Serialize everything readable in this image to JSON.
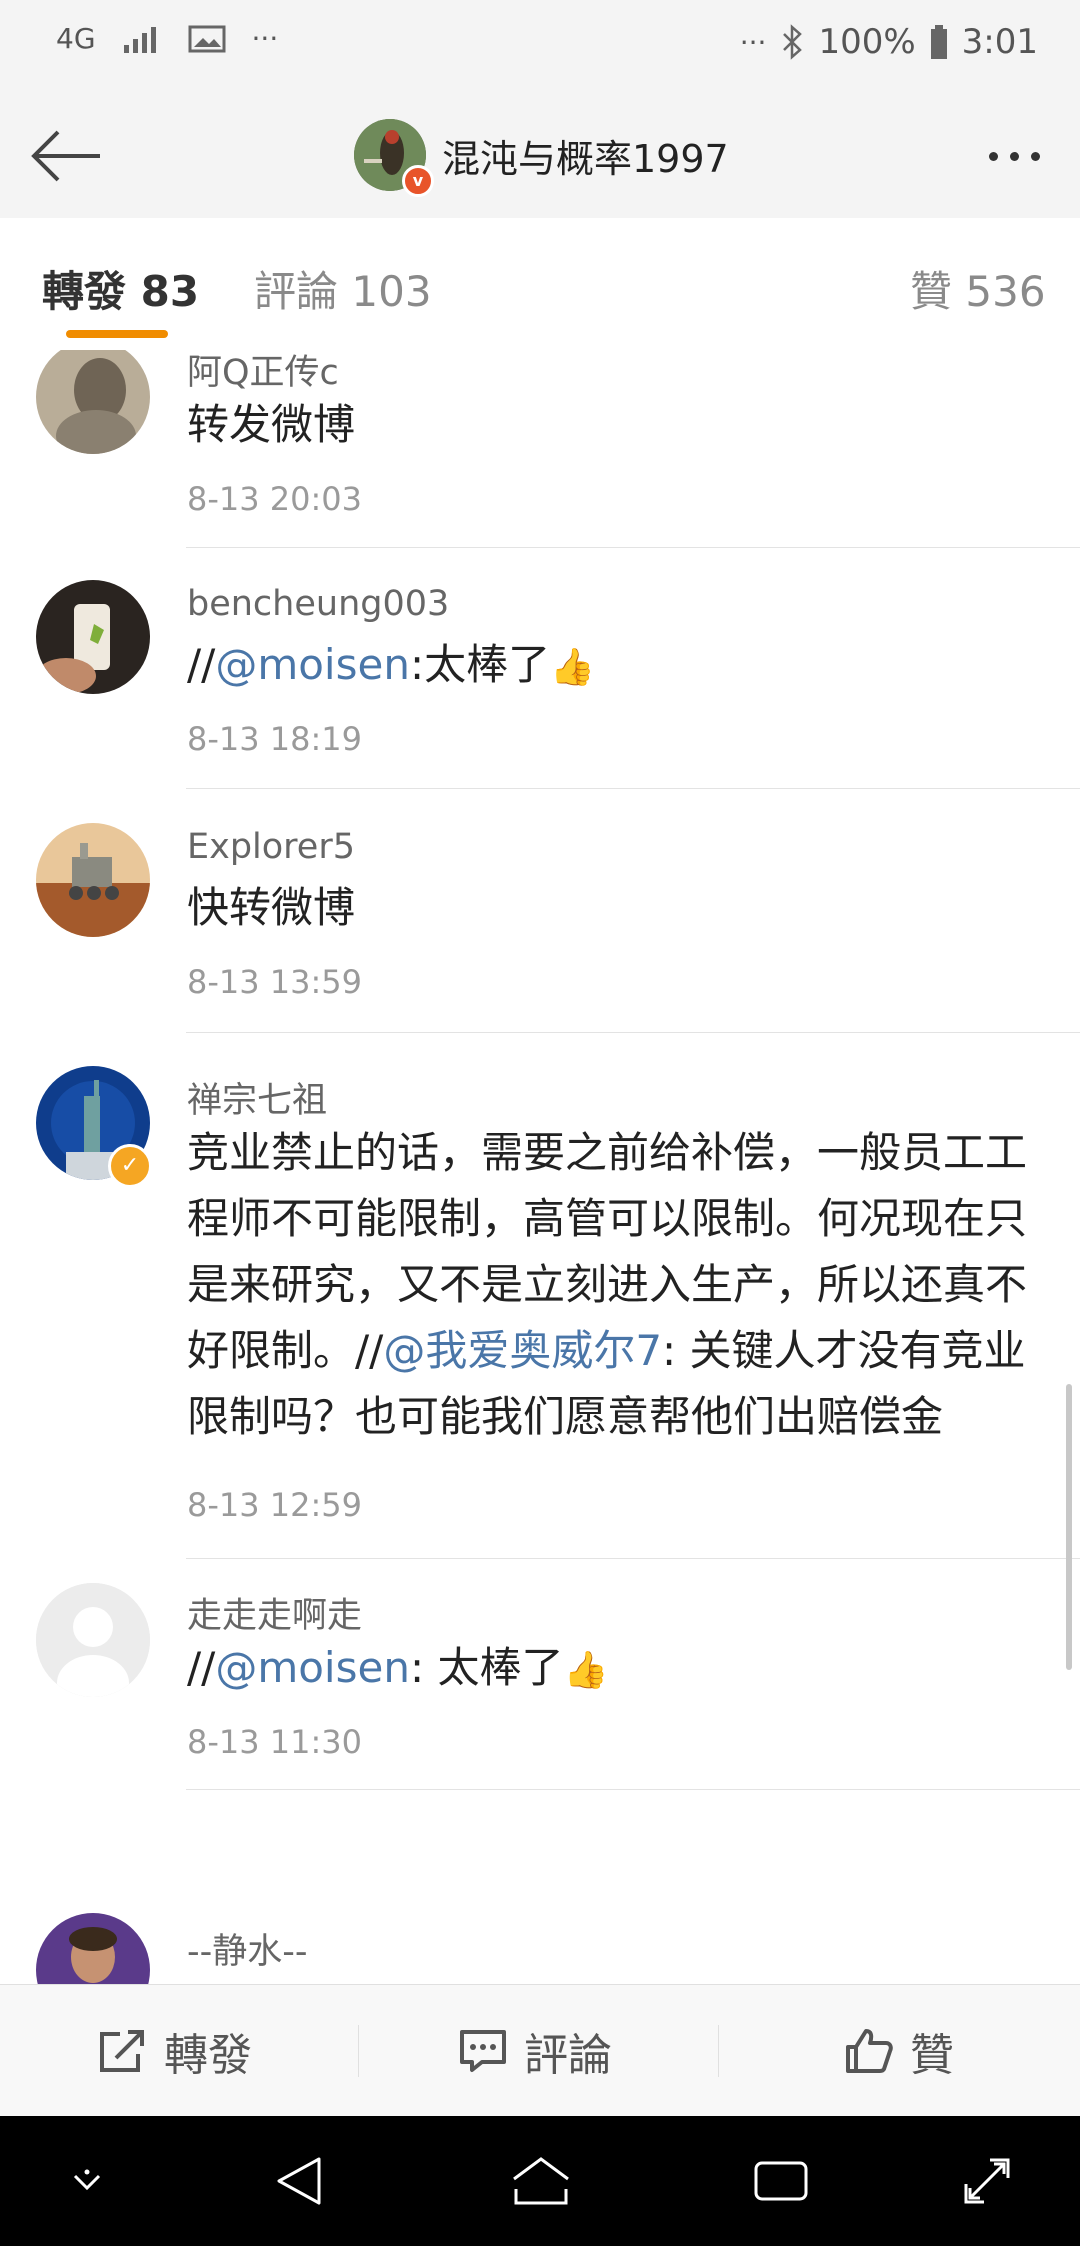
{
  "status_bar": {
    "network": "4G",
    "dots_left": "···",
    "dots_right": "···",
    "battery": "100%",
    "time": "3:01"
  },
  "header": {
    "username": "混沌与概率1997",
    "back_icon": "back-arrow-icon",
    "more_icon": "more-dots-icon"
  },
  "tabs": [
    {
      "label": "轉發",
      "count": "83",
      "active": true
    },
    {
      "label": "評論",
      "count": "103",
      "active": false
    },
    {
      "label": "贊",
      "count": "536",
      "active": false
    }
  ],
  "feed": [
    {
      "username": "阿Q正传c",
      "text": "转发微博",
      "time": "8-13 20:03"
    },
    {
      "username": "bencheung003",
      "text_prefix": "//",
      "mention": "@moisen",
      "text_suffix": ":太棒了",
      "emoji": "👍",
      "time": "8-13 18:19"
    },
    {
      "username": "Explorer5",
      "text": "快转微博",
      "time": "8-13 13:59"
    },
    {
      "username": "禅宗七祖",
      "verified": true,
      "text_prefix": "竞业禁止的话，需要之前给补偿，一般员工工程师不可能限制，高管可以限制。何况现在只是来研究，又不是立刻进入生产，所以还真不好限制。//",
      "mention": "@我爱奥威尔7",
      "text_suffix": ": 关键人才没有竞业限制吗？也可能我们愿意帮他们出赔偿金",
      "time": "8-13 12:59"
    },
    {
      "username": "走走走啊走",
      "text_prefix": "//",
      "mention": "@moisen",
      "text_suffix": ": 太棒了",
      "emoji": "👍",
      "time": "8-13 11:30"
    },
    {
      "username": "--静水--"
    }
  ],
  "bottom_actions": [
    {
      "label": "轉發",
      "icon": "share-icon"
    },
    {
      "label": "評論",
      "icon": "comment-icon"
    },
    {
      "label": "贊",
      "icon": "like-icon"
    }
  ],
  "colors": {
    "accent": "#f08c00",
    "mention": "#4a76a8",
    "verified": "#f5a623"
  }
}
